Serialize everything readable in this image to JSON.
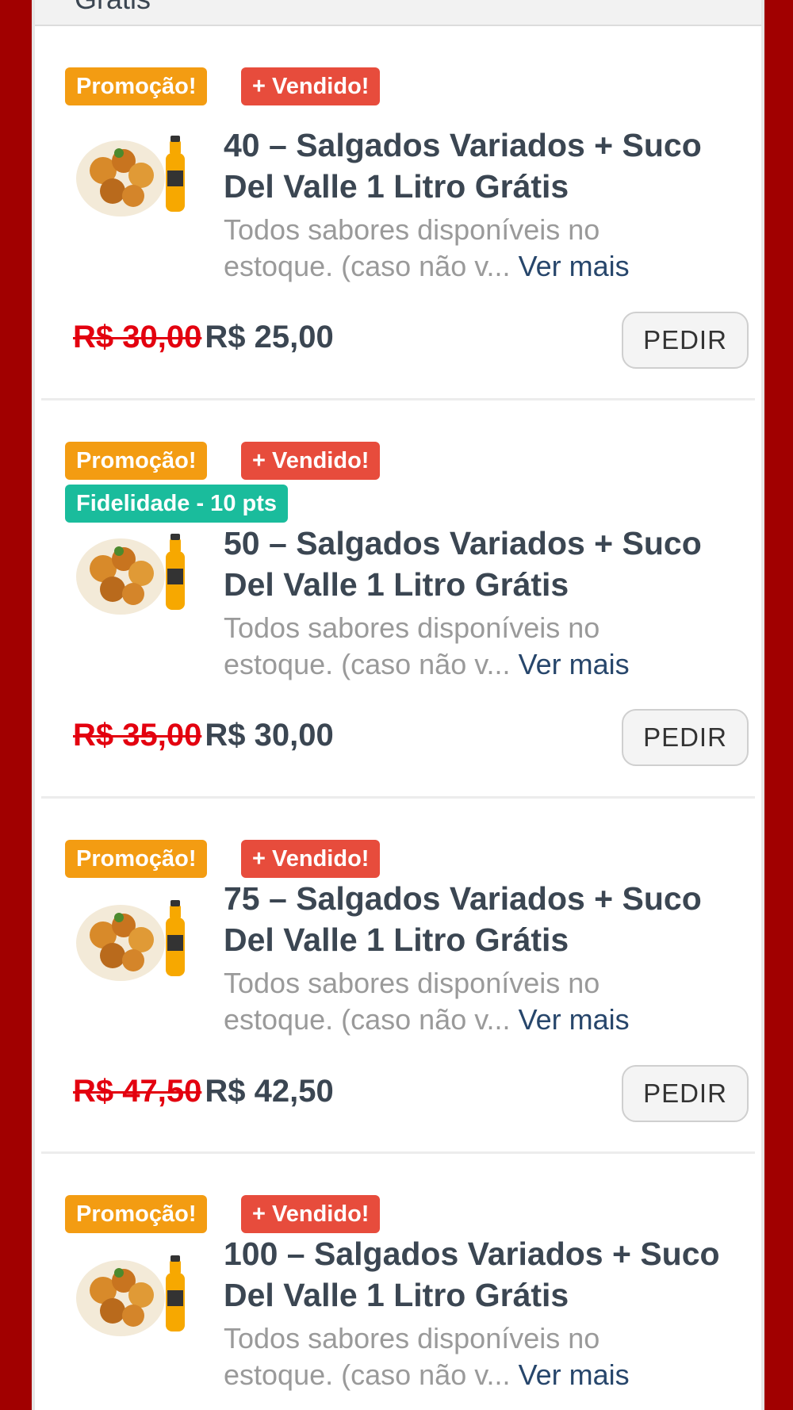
{
  "header_fragment": "Grátis",
  "colors": {
    "background": "#a10000",
    "promo_badge": "#f39c12",
    "sold_badge": "#e74c3c",
    "loyalty_badge": "#1abc9c",
    "old_price": "#e3000f",
    "link": "#27466b"
  },
  "products": [
    {
      "badge_promo": "Promoção!",
      "badge_sold": "+ Vendido!",
      "badge_loyalty": "",
      "title": "40 – Salgados Variados + Suco Del Valle 1 Litro Grátis",
      "description": "Todos sabores disponíveis no estoque. (caso não v...",
      "more_link": "Ver mais",
      "old_price": "R$ 30,00",
      "price": "R$ 25,00",
      "button": "PEDIR"
    },
    {
      "badge_promo": "Promoção!",
      "badge_sold": "+ Vendido!",
      "badge_loyalty": "Fidelidade - 10 pts",
      "title": "50 – Salgados Variados + Suco Del Valle 1 Litro Grátis",
      "description": "Todos sabores disponíveis no estoque. (caso não v...",
      "more_link": "Ver mais",
      "old_price": "R$ 35,00",
      "price": "R$ 30,00",
      "button": "PEDIR"
    },
    {
      "badge_promo": "Promoção!",
      "badge_sold": "+ Vendido!",
      "badge_loyalty": "",
      "title": "75 – Salgados Variados + Suco Del Valle 1 Litro Grátis",
      "description": "Todos sabores disponíveis no estoque. (caso não v...",
      "more_link": "Ver mais",
      "old_price": "R$ 47,50",
      "price": "R$ 42,50",
      "button": "PEDIR"
    },
    {
      "badge_promo": "Promoção!",
      "badge_sold": "+ Vendido!",
      "badge_loyalty": "",
      "title": "100 – Salgados Variados + Suco Del Valle 1 Litro Grátis",
      "description": "Todos sabores disponíveis no estoque. (caso não v...",
      "more_link": "Ver mais",
      "old_price": "",
      "price": "",
      "button": ""
    }
  ]
}
